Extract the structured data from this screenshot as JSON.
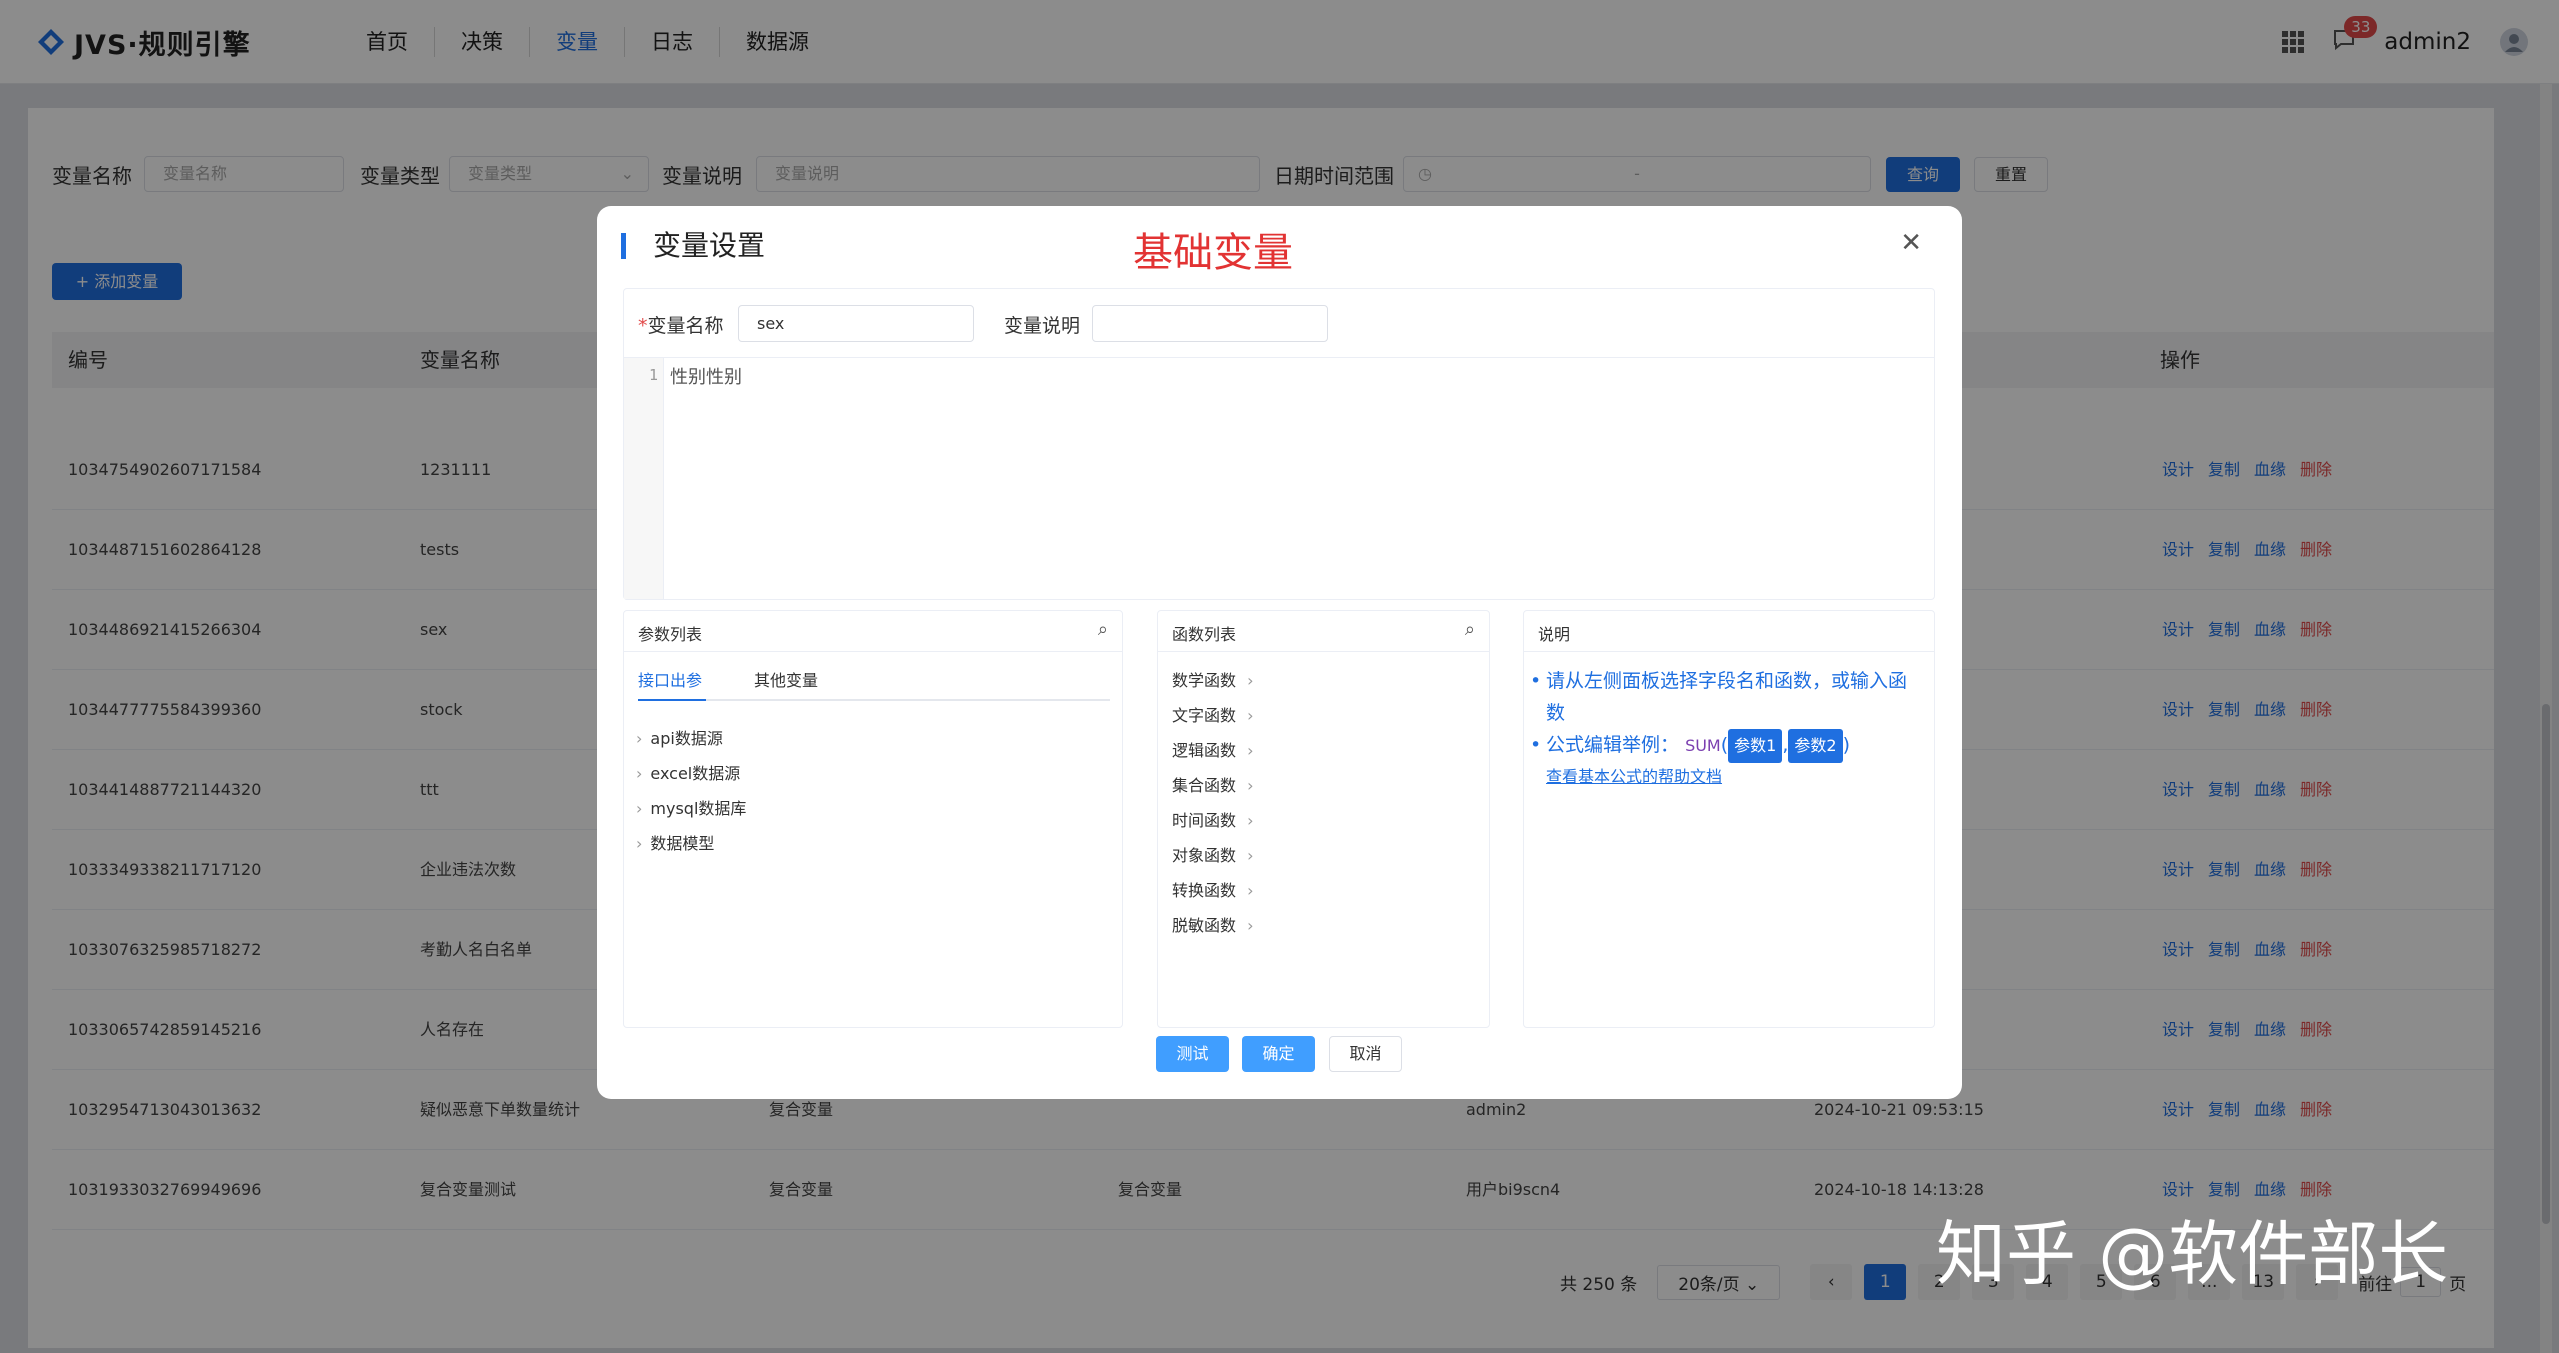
{
  "app": {
    "logo_text": "JVS·规则引擎"
  },
  "nav": [
    {
      "label": "首页",
      "active": false
    },
    {
      "label": "决策",
      "active": false
    },
    {
      "label": "变量",
      "active": true
    },
    {
      "label": "日志",
      "active": false
    },
    {
      "label": "数据源",
      "active": false
    }
  ],
  "header_right": {
    "notification_count": "33",
    "username": "admin2"
  },
  "filters": {
    "name_label": "变量名称",
    "name_placeholder": "变量名称",
    "type_label": "变量类型",
    "type_placeholder": "变量类型",
    "desc_label": "变量说明",
    "desc_placeholder": "变量说明",
    "date_label": "日期时间范围",
    "date_separator": "-",
    "query_button": "查询",
    "reset_button": "重置"
  },
  "add_button": "+ 添加变量",
  "table": {
    "headers": {
      "id": "编号",
      "name": "变量名称",
      "ops": "操作"
    },
    "op_labels": [
      "设计",
      "复制",
      "血缘",
      "删除"
    ],
    "rows": [
      {
        "id": "1034754902607171584",
        "name": "1231111",
        "type": "",
        "desc": "",
        "user": "",
        "time": ""
      },
      {
        "id": "1034487151602864128",
        "name": "tests",
        "type": "",
        "desc": "",
        "user": "",
        "time": ""
      },
      {
        "id": "1034486921415266304",
        "name": "sex",
        "type": "",
        "desc": "",
        "user": "",
        "time": ""
      },
      {
        "id": "1034477775584399360",
        "name": "stock",
        "type": "",
        "desc": "",
        "user": "",
        "time": ""
      },
      {
        "id": "1034414887721144320",
        "name": "ttt",
        "type": "",
        "desc": "",
        "user": "",
        "time": ""
      },
      {
        "id": "1033349338211717120",
        "name": "企业违法次数",
        "type": "",
        "desc": "",
        "user": "",
        "time": ""
      },
      {
        "id": "1033076325985718272",
        "name": "考勤人名白名单",
        "type": "",
        "desc": "",
        "user": "",
        "time": ""
      },
      {
        "id": "1033065742859145216",
        "name": "人名存在",
        "type": "",
        "desc": "",
        "user": "",
        "time": ""
      },
      {
        "id": "1032954713043013632",
        "name": "疑似恶意下单数量统计",
        "type": "复合变量",
        "desc": "",
        "user": "admin2",
        "time": "2024-10-21 09:53:15"
      },
      {
        "id": "1031933032769949696",
        "name": "复合变量测试",
        "type": "复合变量",
        "desc": "复合变量",
        "user": "用户bi9scn4",
        "time": "2024-10-18 14:13:28"
      }
    ]
  },
  "pagination": {
    "total": "共 250 条",
    "page_size": "20条/页",
    "pages": [
      "1",
      "2",
      "3",
      "4",
      "5",
      "6",
      "...",
      "13"
    ],
    "goto_label": "前往",
    "goto_value": "1",
    "goto_suffix": "页"
  },
  "modal": {
    "title": "变量设置",
    "overlay_title": "基础变量",
    "close_icon": "close-icon",
    "name_label": "变量名称",
    "name_value": "sex",
    "desc_label": "变量说明",
    "desc_value": "",
    "editor_line": "1",
    "editor_text": "性别性别",
    "params": {
      "title": "参数列表",
      "tabs": [
        "接口出参",
        "其他变量"
      ],
      "items": [
        "api数据源",
        "excel数据源",
        "mysql数据库",
        "数据模型"
      ]
    },
    "functions": {
      "title": "函数列表",
      "items": [
        "数学函数",
        "文字函数",
        "逻辑函数",
        "集合函数",
        "时间函数",
        "对象函数",
        "转换函数",
        "脱敏函数"
      ]
    },
    "help": {
      "title": "说明",
      "line1": "请从左侧面板选择字段名和函数，或输入函数",
      "line2_prefix": "公式编辑举例：",
      "func": "SUM",
      "param1": "参数1",
      "param2": "参数2",
      "link": "查看基本公式的帮助文档"
    },
    "buttons": {
      "test": "测试",
      "confirm": "确定",
      "cancel": "取消"
    }
  },
  "watermark": "知乎 @软件部长",
  "colors": {
    "primary": "#1f6fe0",
    "danger": "#e24a4a",
    "title_red": "#e23333"
  }
}
